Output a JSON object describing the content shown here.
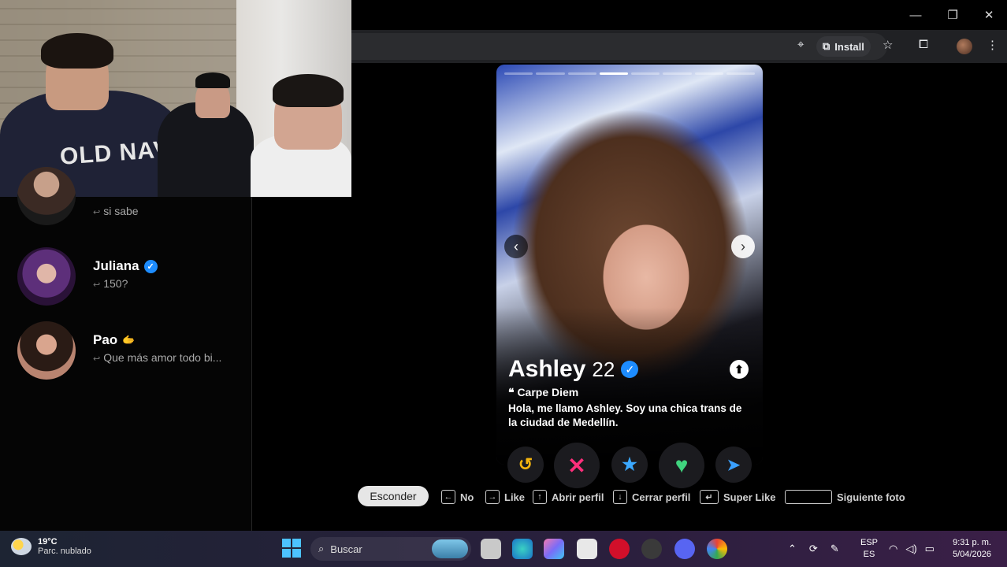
{
  "window_controls": {
    "minimize": "—",
    "restore": "❐",
    "close": "✕"
  },
  "browser": {
    "install_label": "Install",
    "icons": [
      "location-icon",
      "install-icon",
      "star-icon",
      "extensions-icon",
      "menu-icon"
    ]
  },
  "webcam": {
    "hoodie_text": "OLD NAV"
  },
  "sidebar": {
    "matches": [
      {
        "name": "",
        "message": "si sabe",
        "verified": false
      },
      {
        "name": "Juliana",
        "message": "150?",
        "verified": true
      },
      {
        "name": "Pao",
        "badge": "🫱",
        "message": "Que más amor todo bi...",
        "verified": false
      }
    ]
  },
  "profile": {
    "name": "Ashley",
    "age": "22",
    "quote_mark": "❝",
    "quote": "Carpe Diem",
    "bio": "Hola, me llamo Ashley. Soy una chica trans de la ciudad de Medellín.",
    "photo_count": 8,
    "active_photo_index": 3
  },
  "actions": {
    "rewind": "↺",
    "nope": "✕",
    "super_like": "★",
    "like": "♥",
    "boost": "➤"
  },
  "hints": {
    "hide": "Esconder",
    "no": "No",
    "like": "Like",
    "open_profile": "Abrir perfil",
    "close_profile": "Cerrar perfil",
    "super_like": "Super Like",
    "next_photo": "Siguiente foto"
  },
  "taskbar": {
    "temperature": "19°C",
    "weather": "Parc. nublado",
    "search_placeholder": "Buscar",
    "lang_top": "ESP",
    "lang_bottom": "ES",
    "time": "9:31 p. m.",
    "date": "5/04/2026"
  }
}
